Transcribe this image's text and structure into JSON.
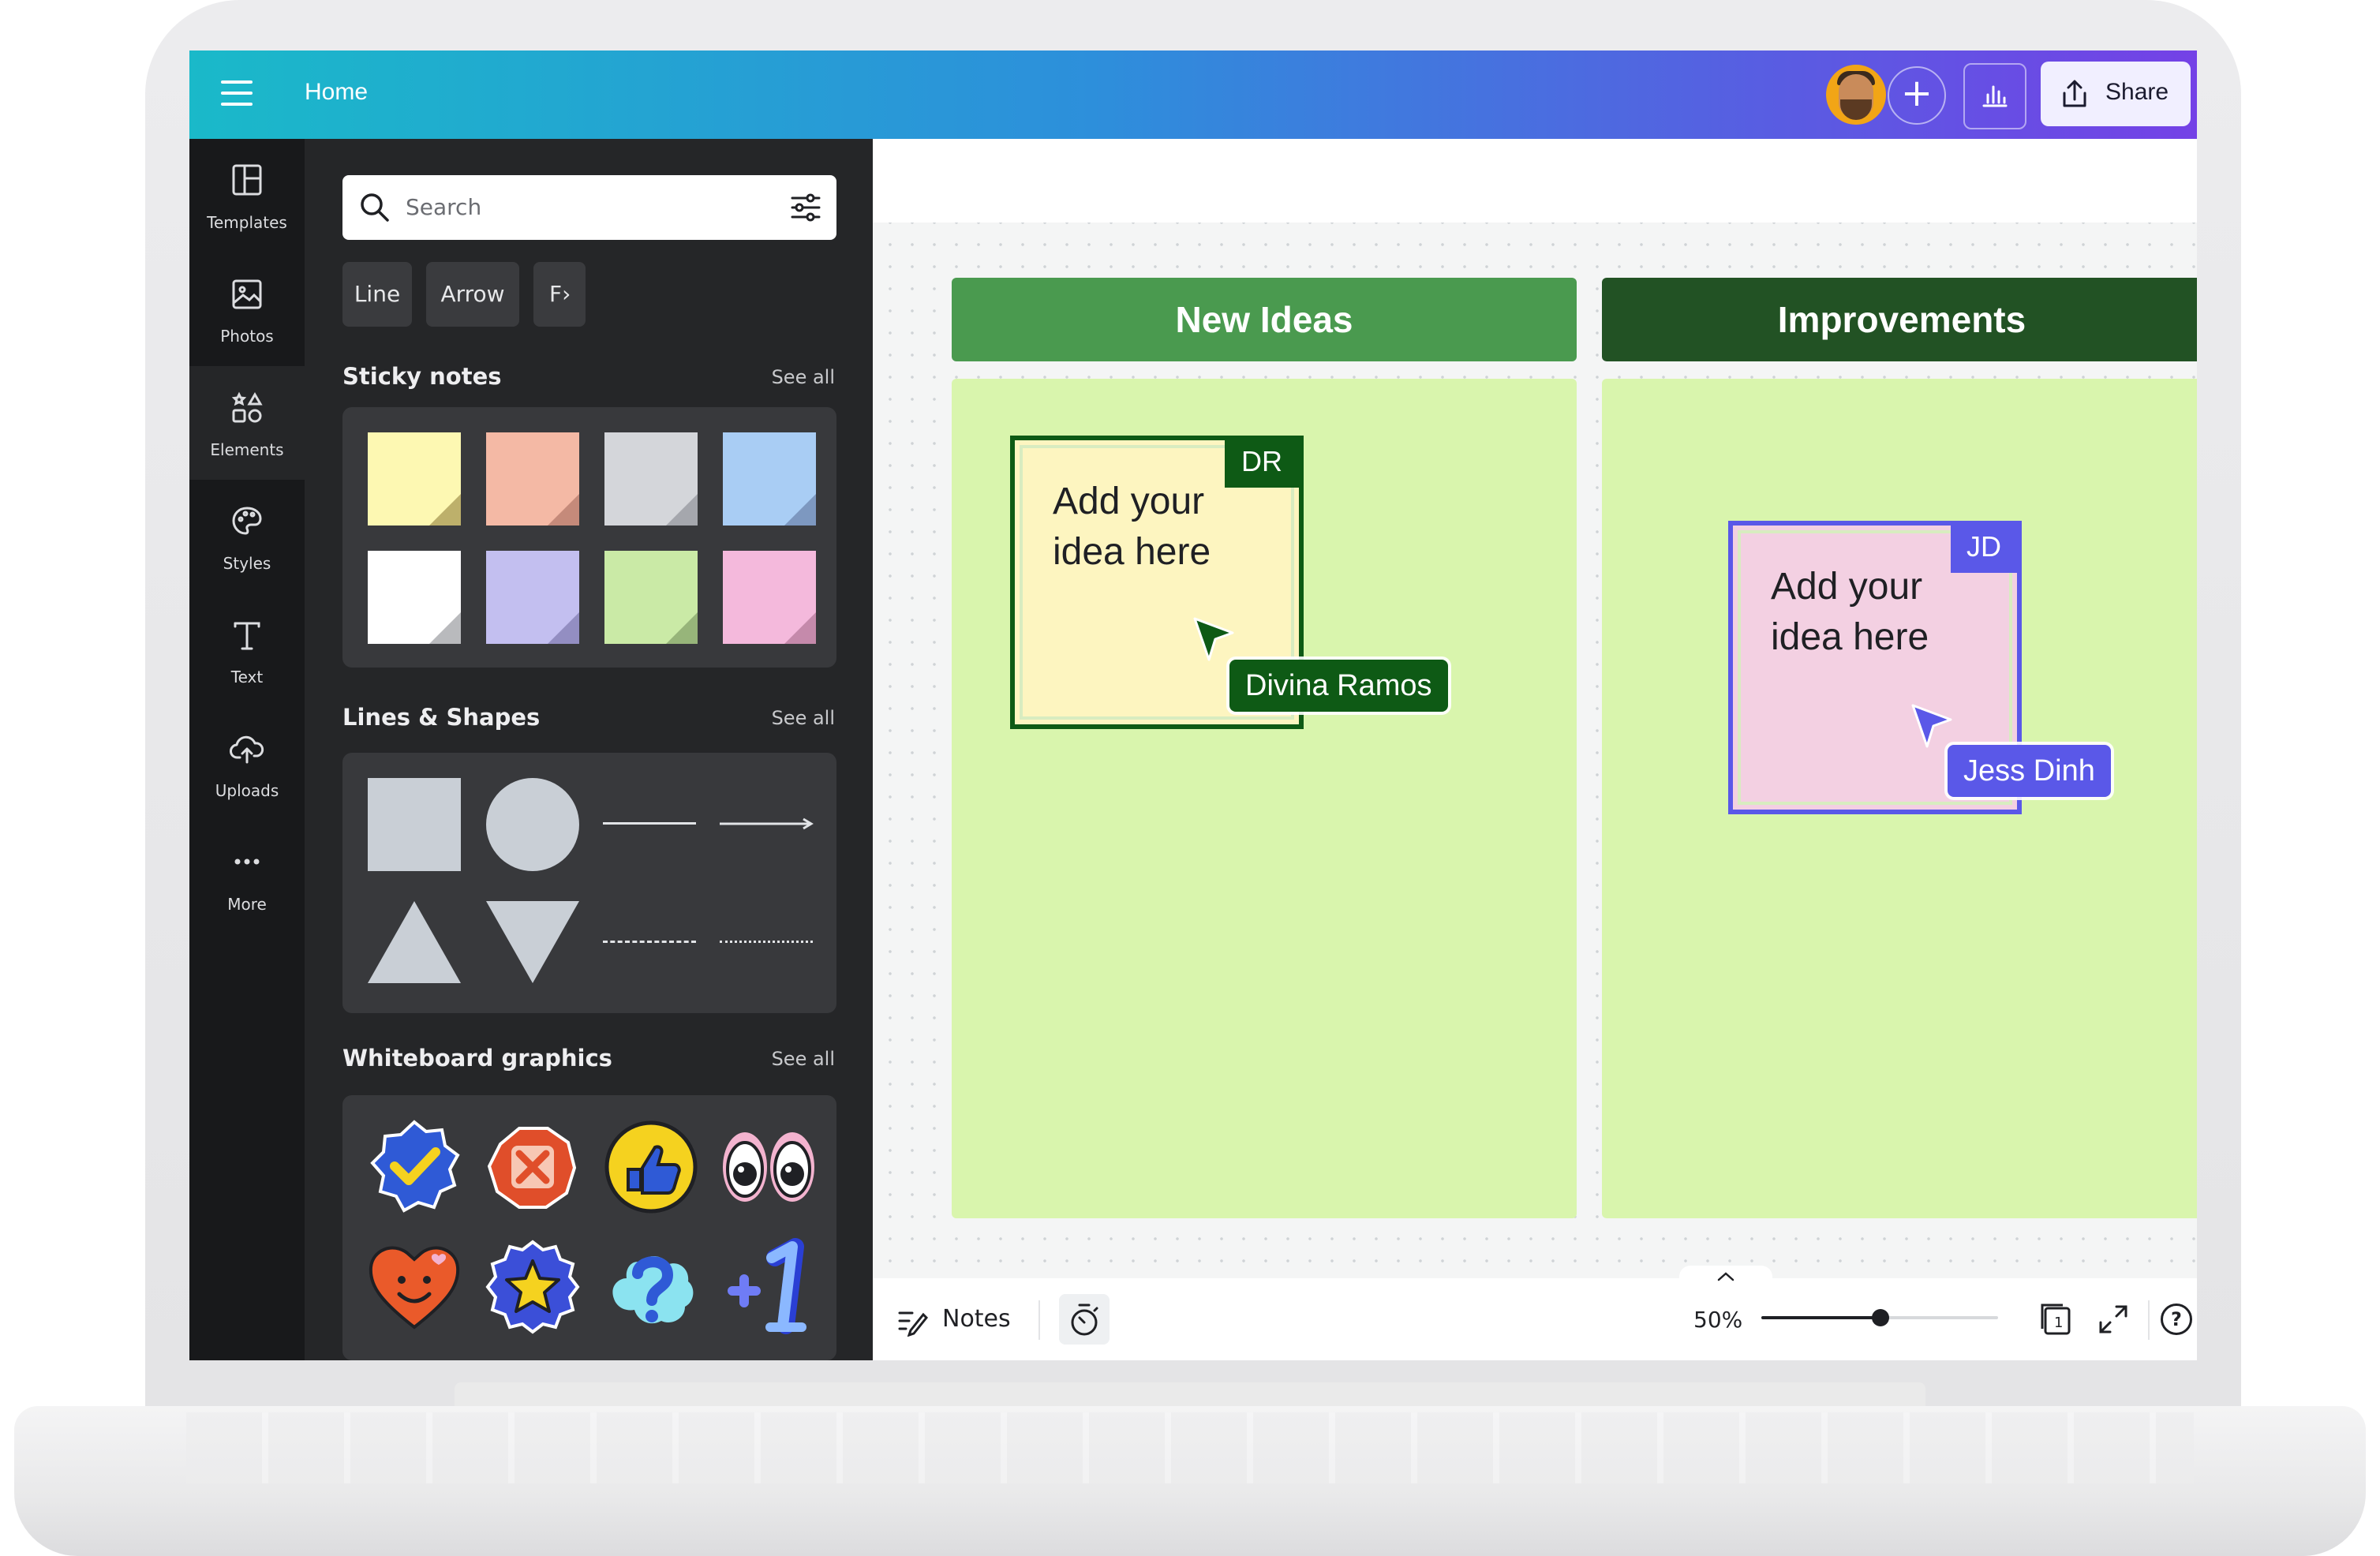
{
  "app": {
    "home_label": "Home",
    "share_label": "Share",
    "avatar_name": "user-avatar"
  },
  "rail": [
    {
      "label": "Templates",
      "icon": "templates-icon"
    },
    {
      "label": "Photos",
      "icon": "photos-icon"
    },
    {
      "label": "Elements",
      "icon": "elements-icon",
      "active": true
    },
    {
      "label": "Styles",
      "icon": "styles-icon"
    },
    {
      "label": "Text",
      "icon": "text-icon"
    },
    {
      "label": "Uploads",
      "icon": "uploads-icon"
    },
    {
      "label": "More",
      "icon": "more-icon"
    }
  ],
  "panel": {
    "search_placeholder": "Search",
    "chips": [
      "Line",
      "Arrow",
      "F"
    ],
    "sections": [
      {
        "title": "Sticky notes",
        "see_all": "See all"
      },
      {
        "title": "Lines & Shapes",
        "see_all": "See all"
      },
      {
        "title": "Whiteboard graphics",
        "see_all": "See all"
      }
    ],
    "sticky_colors": [
      "#fdf8b2",
      "#f4b9a5",
      "#d4d6da",
      "#a9cdf4",
      "#ffffff",
      "#c3bff0",
      "#caeaa6",
      "#f4b9dc"
    ],
    "sticky_fold_colors": [
      "#bdb06b",
      "#c58a7a",
      "#a5a7ad",
      "#7d98c0",
      "#b9babd",
      "#938ec2",
      "#97b57a",
      "#c58aab"
    ]
  },
  "board": {
    "columns": [
      {
        "title": "New Ideas",
        "color": "#4a9a4f"
      },
      {
        "title": "Improvements",
        "color": "#225224"
      }
    ],
    "notes": [
      {
        "text_line1": "Add your",
        "text_line2": "idea here",
        "initials": "DR",
        "user": "Divina Ramos",
        "color": "#fdf5c0",
        "accent": "#0e5a15"
      },
      {
        "text_line1": "Add your",
        "text_line2": "idea here",
        "initials": "JD",
        "user": "Jess Dinh",
        "color": "#f3d0e2",
        "accent": "#5a58e8"
      }
    ]
  },
  "bottombar": {
    "notes_label": "Notes",
    "zoom_label": "50%",
    "zoom_level": 0.5,
    "page_number": "1",
    "help_label": "?"
  }
}
